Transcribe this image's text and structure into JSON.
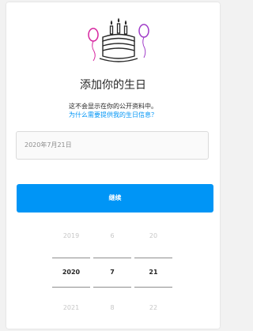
{
  "title": "添加你的生日",
  "subtitle": {
    "line1": "这不会显示在你的公开资料中。",
    "line2": "为什么需要提供我的生日信息？"
  },
  "date_field": {
    "value": "2020年7月21日"
  },
  "continue_button": {
    "label": "继续"
  },
  "picker": {
    "year": {
      "prev": "2019",
      "selected": "2020",
      "next": "2021"
    },
    "month": {
      "prev": "6",
      "selected": "7",
      "next": "8"
    },
    "day": {
      "prev": "20",
      "selected": "21",
      "next": "22"
    }
  },
  "colors": {
    "accent": "#0095f6",
    "text": "#262626",
    "muted": "#8e8e8e",
    "cake_outline": "#262626",
    "balloon_left": "#d6249f",
    "balloon_right": "#833ab4"
  }
}
